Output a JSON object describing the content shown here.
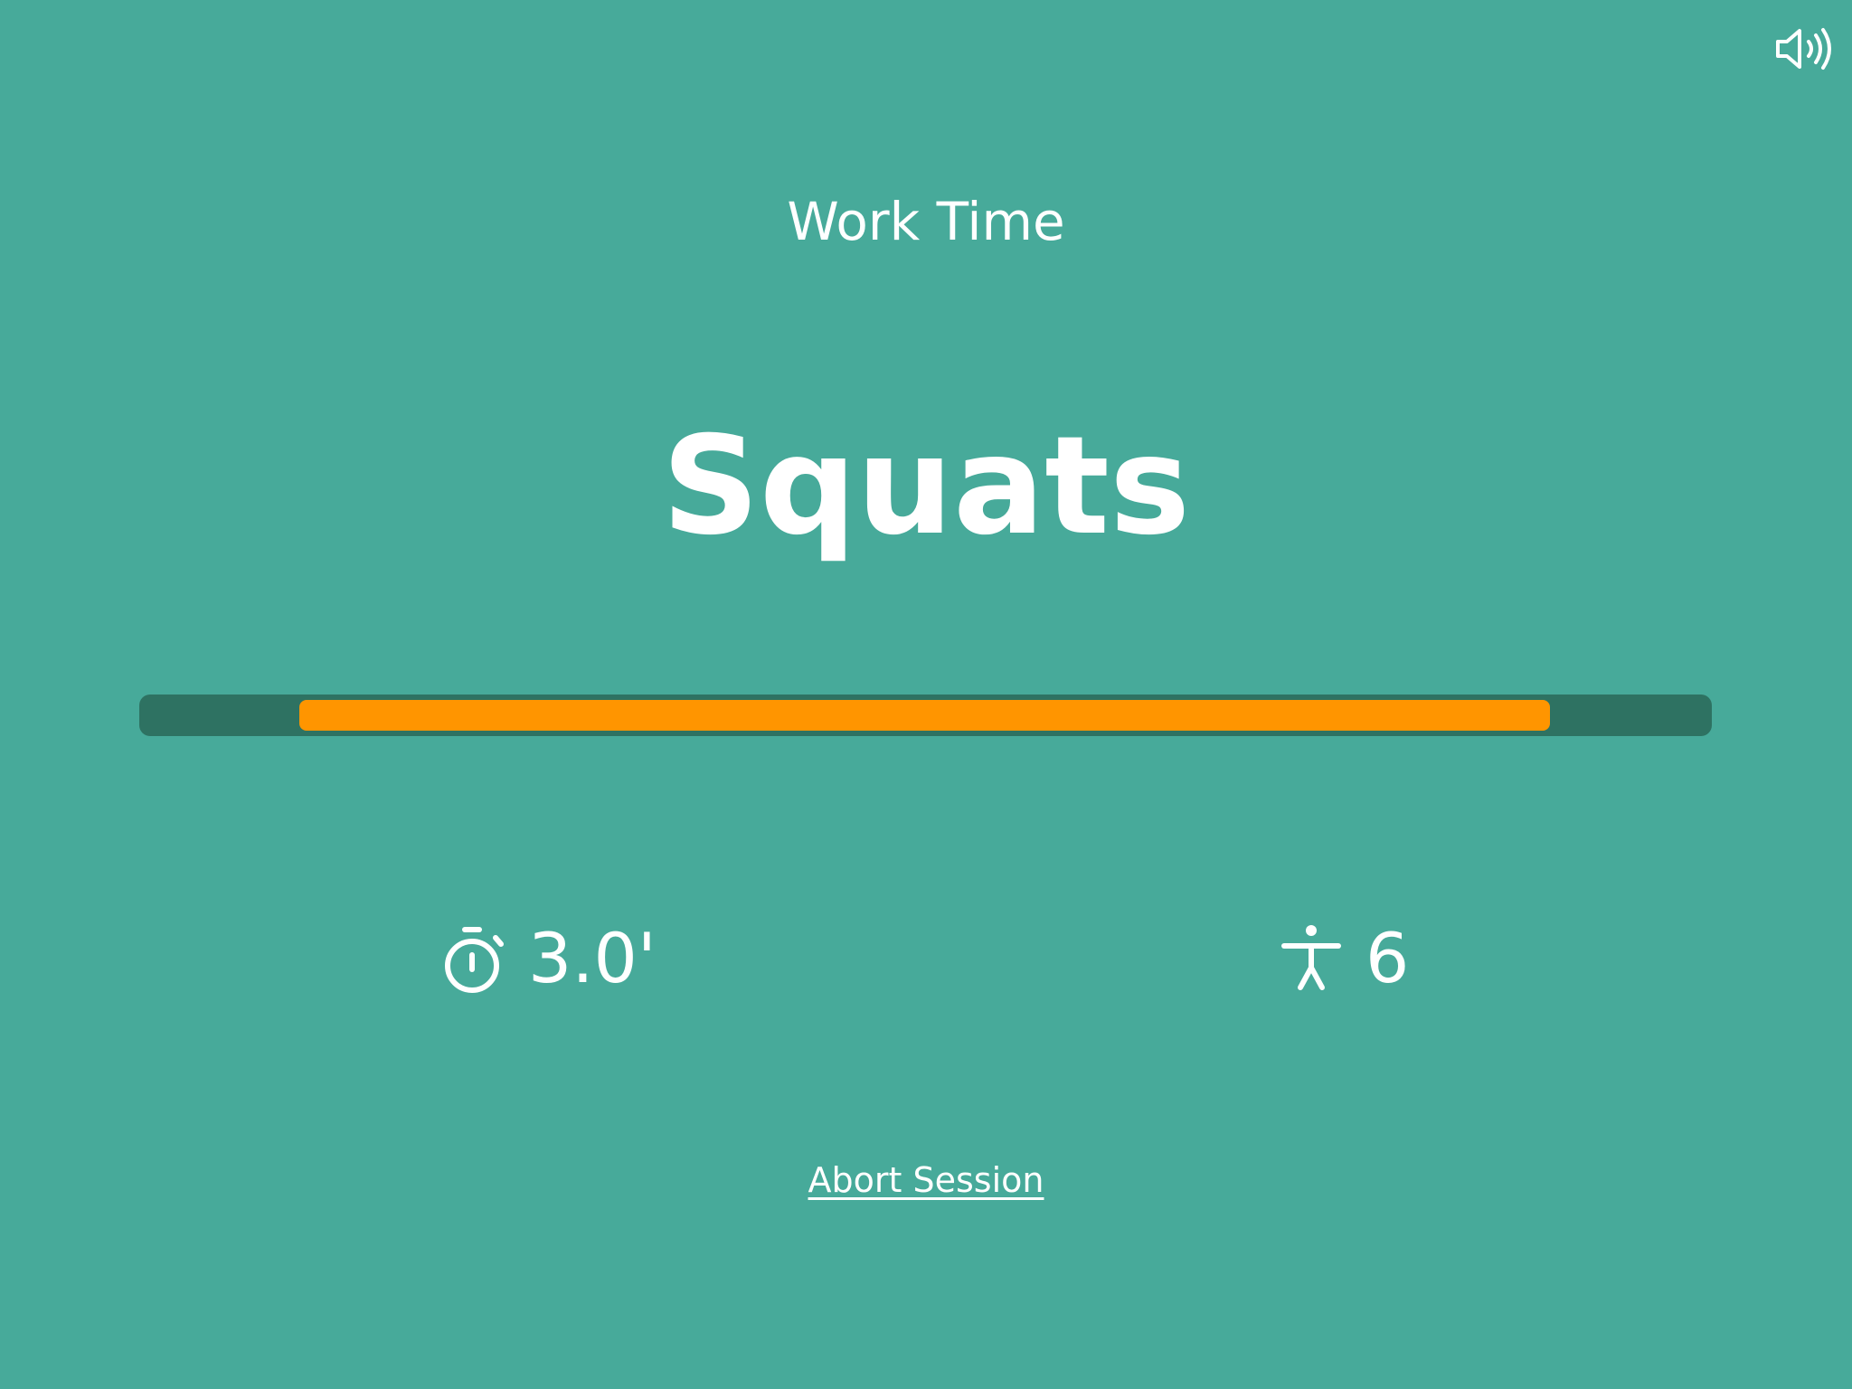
{
  "header": {
    "sound_icon": "speaker-volume-icon"
  },
  "session": {
    "phase_label": "Work Time",
    "exercise_name": "Squats",
    "progress_fraction": 0.795,
    "progress_offset_fraction": 0.102
  },
  "stats": {
    "time_icon": "stopwatch-icon",
    "time_value": "3.0'",
    "rounds_icon": "person-figure-icon",
    "rounds_value": "6"
  },
  "footer": {
    "abort_label": "Abort Session"
  },
  "colors": {
    "background": "#47aa9a",
    "track": "#2e7262",
    "progress": "#ff9500",
    "text": "#ffffff"
  }
}
